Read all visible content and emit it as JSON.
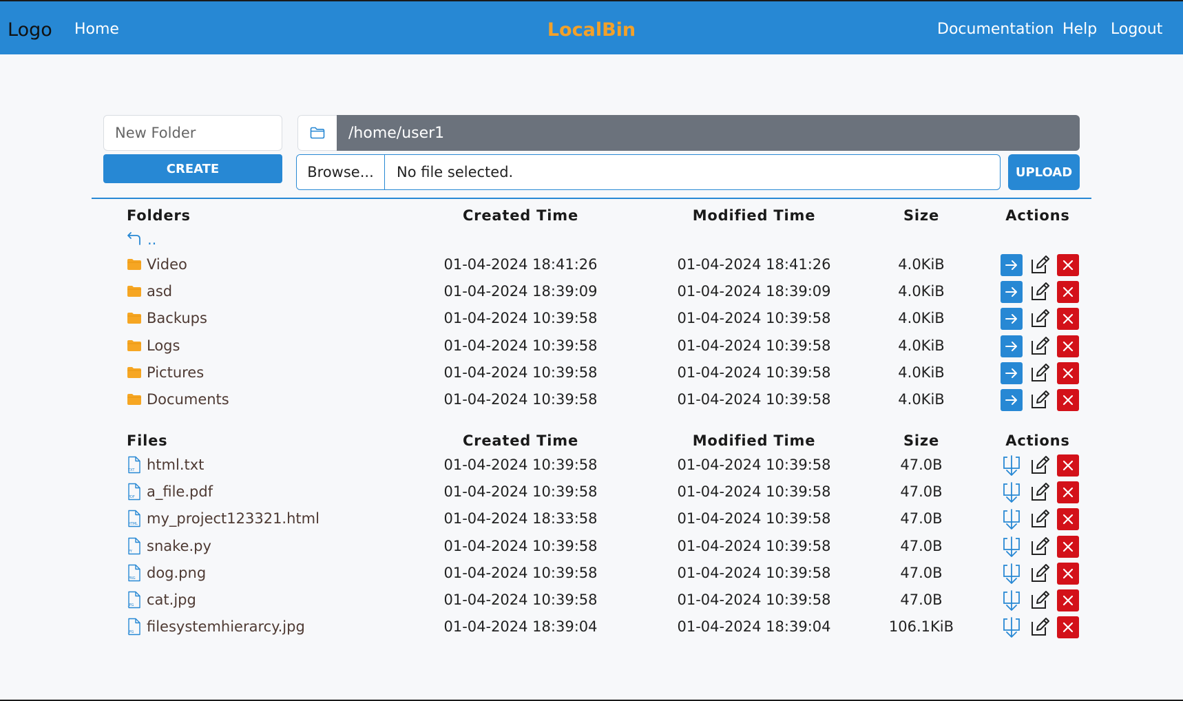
{
  "nav": {
    "logo": "Logo",
    "home": "Home",
    "brand": "LocalBin",
    "documentation": "Documentation",
    "help": "Help",
    "logout": "Logout",
    "bar_color": "#2788d4",
    "brand_color": "#f2a12a"
  },
  "toolbar": {
    "new_folder_placeholder": "New Folder",
    "create_label": "CREATE",
    "path_icon": "folder-icon",
    "current_path": "/home/user1",
    "browse_label": "Browse...",
    "file_status": "No file selected.",
    "upload_label": "UPLOAD"
  },
  "folders": {
    "headers": {
      "name": "Folders",
      "created": "Created Time",
      "modified": "Modified Time",
      "size": "Size",
      "actions": "Actions"
    },
    "parent_link": "..",
    "items": [
      {
        "name": "Video",
        "created": "01-04-2024 18:41:26",
        "modified": "01-04-2024 18:41:26",
        "size": "4.0KiB"
      },
      {
        "name": "asd",
        "created": "01-04-2024 18:39:09",
        "modified": "01-04-2024 18:39:09",
        "size": "4.0KiB"
      },
      {
        "name": "Backups",
        "created": "01-04-2024 10:39:58",
        "modified": "01-04-2024 10:39:58",
        "size": "4.0KiB"
      },
      {
        "name": "Logs",
        "created": "01-04-2024 10:39:58",
        "modified": "01-04-2024 10:39:58",
        "size": "4.0KiB"
      },
      {
        "name": "Pictures",
        "created": "01-04-2024 10:39:58",
        "modified": "01-04-2024 10:39:58",
        "size": "4.0KiB"
      },
      {
        "name": "Documents",
        "created": "01-04-2024 10:39:58",
        "modified": "01-04-2024 10:39:58",
        "size": "4.0KiB"
      }
    ]
  },
  "files": {
    "headers": {
      "name": "Files",
      "created": "Created Time",
      "modified": "Modified Time",
      "size": "Size",
      "actions": "Actions"
    },
    "items": [
      {
        "name": "html.txt",
        "type": "TXT",
        "created": "01-04-2024 10:39:58",
        "modified": "01-04-2024 10:39:58",
        "size": "47.0B"
      },
      {
        "name": "a_file.pdf",
        "type": "PDF",
        "created": "01-04-2024 10:39:58",
        "modified": "01-04-2024 10:39:58",
        "size": "47.0B"
      },
      {
        "name": "my_project123321.html",
        "type": "HTML",
        "created": "01-04-2024 18:33:58",
        "modified": "01-04-2024 10:39:58",
        "size": "47.0B"
      },
      {
        "name": "snake.py",
        "type": "PY",
        "created": "01-04-2024 10:39:58",
        "modified": "01-04-2024 10:39:58",
        "size": "47.0B"
      },
      {
        "name": "dog.png",
        "type": "PNG",
        "created": "01-04-2024 10:39:58",
        "modified": "01-04-2024 10:39:58",
        "size": "47.0B"
      },
      {
        "name": "cat.jpg",
        "type": "JPG",
        "created": "01-04-2024 10:39:58",
        "modified": "01-04-2024 10:39:58",
        "size": "47.0B"
      },
      {
        "name": "filesystemhierarcy.jpg",
        "type": "JPG",
        "created": "01-04-2024 18:39:04",
        "modified": "01-04-2024 18:39:04",
        "size": "106.1KiB"
      }
    ]
  },
  "icons": {
    "folder_row": "folder-icon",
    "file_row": "file-icon",
    "parent": "return-arrow-icon",
    "open": "arrow-right-icon",
    "download": "download-icon",
    "edit": "edit-icon",
    "delete": "close-icon"
  },
  "colors": {
    "accent": "#2788d4",
    "danger": "#d31119",
    "folder": "#f6a623",
    "path_bg": "#6b727c"
  }
}
